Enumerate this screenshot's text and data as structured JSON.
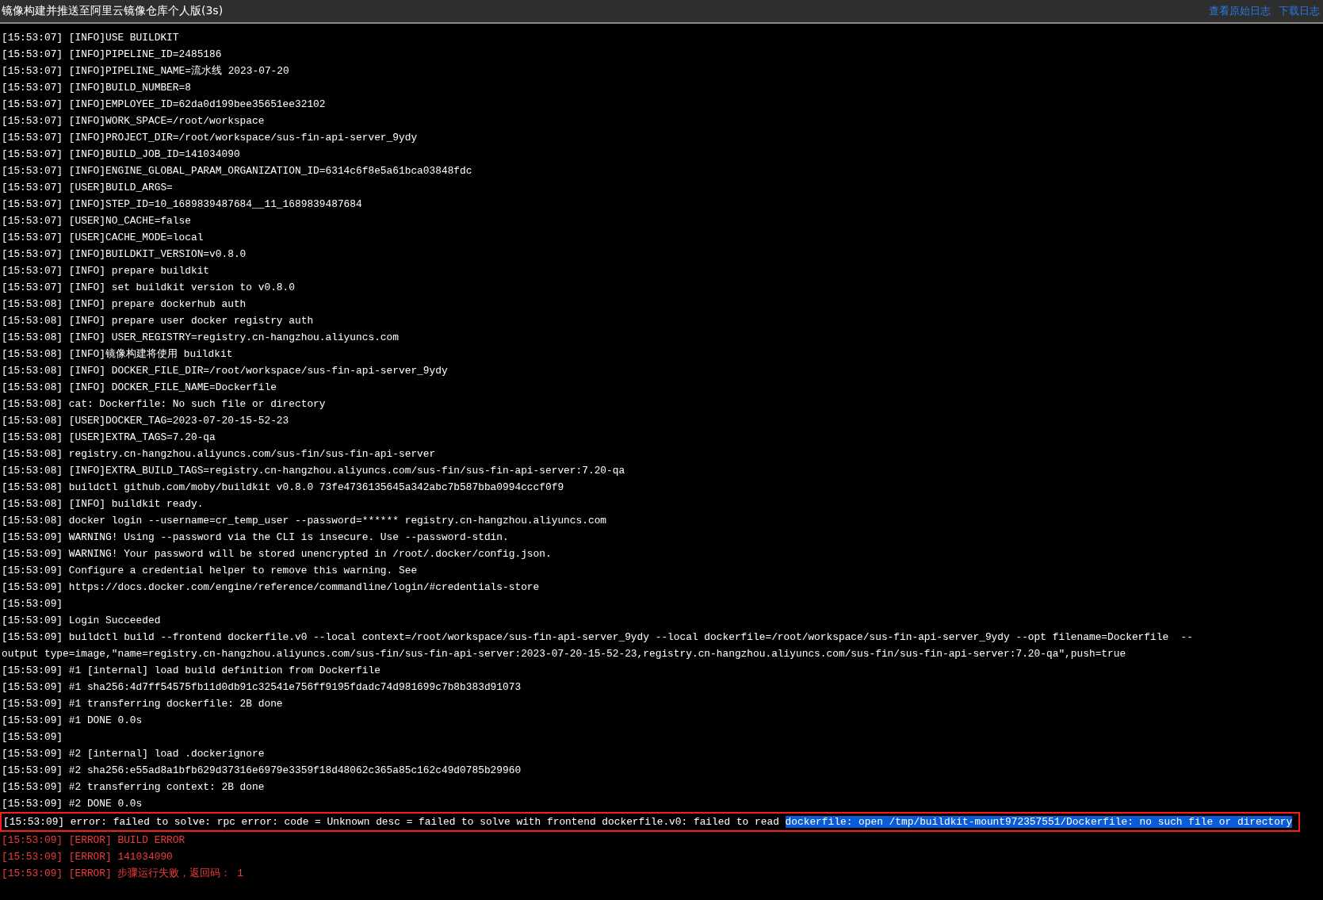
{
  "header": {
    "title": "镜像构建并推送至阿里云镜像仓库个人版(3s)",
    "links": [
      "查看原始日志",
      "下载日志"
    ]
  },
  "log": [
    {
      "kind": "info",
      "text": "[15:53:07] [INFO]USE BUILDKIT"
    },
    {
      "kind": "info",
      "text": "[15:53:07] [INFO]PIPELINE_ID=2485186"
    },
    {
      "kind": "info",
      "text": "[15:53:07] [INFO]PIPELINE_NAME=流水线 2023-07-20"
    },
    {
      "kind": "info",
      "text": "[15:53:07] [INFO]BUILD_NUMBER=8"
    },
    {
      "kind": "info",
      "text": "[15:53:07] [INFO]EMPLOYEE_ID=62da0d199bee35651ee32102"
    },
    {
      "kind": "info",
      "text": "[15:53:07] [INFO]WORK_SPACE=/root/workspace"
    },
    {
      "kind": "info",
      "text": "[15:53:07] [INFO]PROJECT_DIR=/root/workspace/sus-fin-api-server_9ydy"
    },
    {
      "kind": "info",
      "text": "[15:53:07] [INFO]BUILD_JOB_ID=141034090"
    },
    {
      "kind": "info",
      "text": "[15:53:07] [INFO]ENGINE_GLOBAL_PARAM_ORGANIZATION_ID=6314c6f8e5a61bca03848fdc"
    },
    {
      "kind": "info",
      "text": "[15:53:07] [USER]BUILD_ARGS="
    },
    {
      "kind": "info",
      "text": "[15:53:07] [INFO]STEP_ID=10_1689839487684__11_1689839487684"
    },
    {
      "kind": "info",
      "text": "[15:53:07] [USER]NO_CACHE=false"
    },
    {
      "kind": "info",
      "text": "[15:53:07] [USER]CACHE_MODE=local"
    },
    {
      "kind": "info",
      "text": "[15:53:07] [INFO]BUILDKIT_VERSION=v0.8.0"
    },
    {
      "kind": "info",
      "text": "[15:53:07] [INFO] prepare buildkit"
    },
    {
      "kind": "info",
      "text": "[15:53:07] [INFO] set buildkit version to v0.8.0"
    },
    {
      "kind": "info",
      "text": "[15:53:08] [INFO] prepare dockerhub auth"
    },
    {
      "kind": "info",
      "text": "[15:53:08] [INFO] prepare user docker registry auth"
    },
    {
      "kind": "info",
      "text": "[15:53:08] [INFO] USER_REGISTRY=registry.cn-hangzhou.aliyuncs.com"
    },
    {
      "kind": "info",
      "text": "[15:53:08] [INFO]镜像构建将使用 buildkit"
    },
    {
      "kind": "info",
      "text": "[15:53:08] [INFO] DOCKER_FILE_DIR=/root/workspace/sus-fin-api-server_9ydy"
    },
    {
      "kind": "info",
      "text": "[15:53:08] [INFO] DOCKER_FILE_NAME=Dockerfile"
    },
    {
      "kind": "info",
      "text": "[15:53:08] cat: Dockerfile: No such file or directory"
    },
    {
      "kind": "info",
      "text": "[15:53:08] [USER]DOCKER_TAG=2023-07-20-15-52-23"
    },
    {
      "kind": "info",
      "text": "[15:53:08] [USER]EXTRA_TAGS=7.20-qa"
    },
    {
      "kind": "info",
      "text": "[15:53:08] registry.cn-hangzhou.aliyuncs.com/sus-fin/sus-fin-api-server"
    },
    {
      "kind": "info",
      "text": "[15:53:08] [INFO]EXTRA_BUILD_TAGS=registry.cn-hangzhou.aliyuncs.com/sus-fin/sus-fin-api-server:7.20-qa"
    },
    {
      "kind": "info",
      "text": "[15:53:08] buildctl github.com/moby/buildkit v0.8.0 73fe4736135645a342abc7b587bba0994cccf0f9"
    },
    {
      "kind": "info",
      "text": "[15:53:08] [INFO] buildkit ready."
    },
    {
      "kind": "info",
      "text": "[15:53:08] docker login --username=cr_temp_user --password=****** registry.cn-hangzhou.aliyuncs.com"
    },
    {
      "kind": "info",
      "text": "[15:53:09] WARNING! Using --password via the CLI is insecure. Use --password-stdin."
    },
    {
      "kind": "info",
      "text": "[15:53:09] WARNING! Your password will be stored unencrypted in /root/.docker/config.json."
    },
    {
      "kind": "info",
      "text": "[15:53:09] Configure a credential helper to remove this warning. See"
    },
    {
      "kind": "info",
      "text": "[15:53:09] https://docs.docker.com/engine/reference/commandline/login/#credentials-store"
    },
    {
      "kind": "info",
      "text": "[15:53:09]"
    },
    {
      "kind": "info",
      "text": "[15:53:09] Login Succeeded"
    },
    {
      "kind": "info",
      "text": "[15:53:09] buildctl build --frontend dockerfile.v0 --local context=/root/workspace/sus-fin-api-server_9ydy --local dockerfile=/root/workspace/sus-fin-api-server_9ydy --opt filename=Dockerfile  -- output type=image,\"name=registry.cn-hangzhou.aliyuncs.com/sus-fin/sus-fin-api-server:2023-07-20-15-52-23,registry.cn-hangzhou.aliyuncs.com/sus-fin/sus-fin-api-server:7.20-qa\",push=true"
    },
    {
      "kind": "info",
      "text": "[15:53:09] #1 [internal] load build definition from Dockerfile"
    },
    {
      "kind": "info",
      "text": "[15:53:09] #1 sha256:4d7ff54575fb11d0db91c32541e756ff9195fdadc74d981699c7b8b383d91073"
    },
    {
      "kind": "info",
      "text": "[15:53:09] #1 transferring dockerfile: 2B done"
    },
    {
      "kind": "info",
      "text": "[15:53:09] #1 DONE 0.0s"
    },
    {
      "kind": "info",
      "text": "[15:53:09]"
    },
    {
      "kind": "info",
      "text": "[15:53:09] #2 [internal] load .dockerignore"
    },
    {
      "kind": "info",
      "text": "[15:53:09] #2 sha256:e55ad8a1bfb629d37316e6979e3359f18d48062c365a85c162c49d0785b29960"
    },
    {
      "kind": "info",
      "text": "[15:53:09] #2 transferring context: 2B done"
    },
    {
      "kind": "info",
      "text": "[15:53:09] #2 DONE 0.0s"
    },
    {
      "kind": "marked",
      "text": "[15:53:09] error: failed to solve: rpc error: code = Unknown desc = failed to solve with frontend dockerfile.v0: failed to read ",
      "selected_text": "dockerfile: open /tmp/buildkit-mount972357551/Dockerfile: no such file or directory"
    },
    {
      "kind": "error",
      "text": "[15:53:09] [ERROR] BUILD ERROR"
    },
    {
      "kind": "error",
      "text": "[15:53:09] [ERROR] 141034090"
    },
    {
      "kind": "error",
      "text": "[15:53:09] [ERROR] 步骤运行失败，返回码： 1"
    }
  ]
}
